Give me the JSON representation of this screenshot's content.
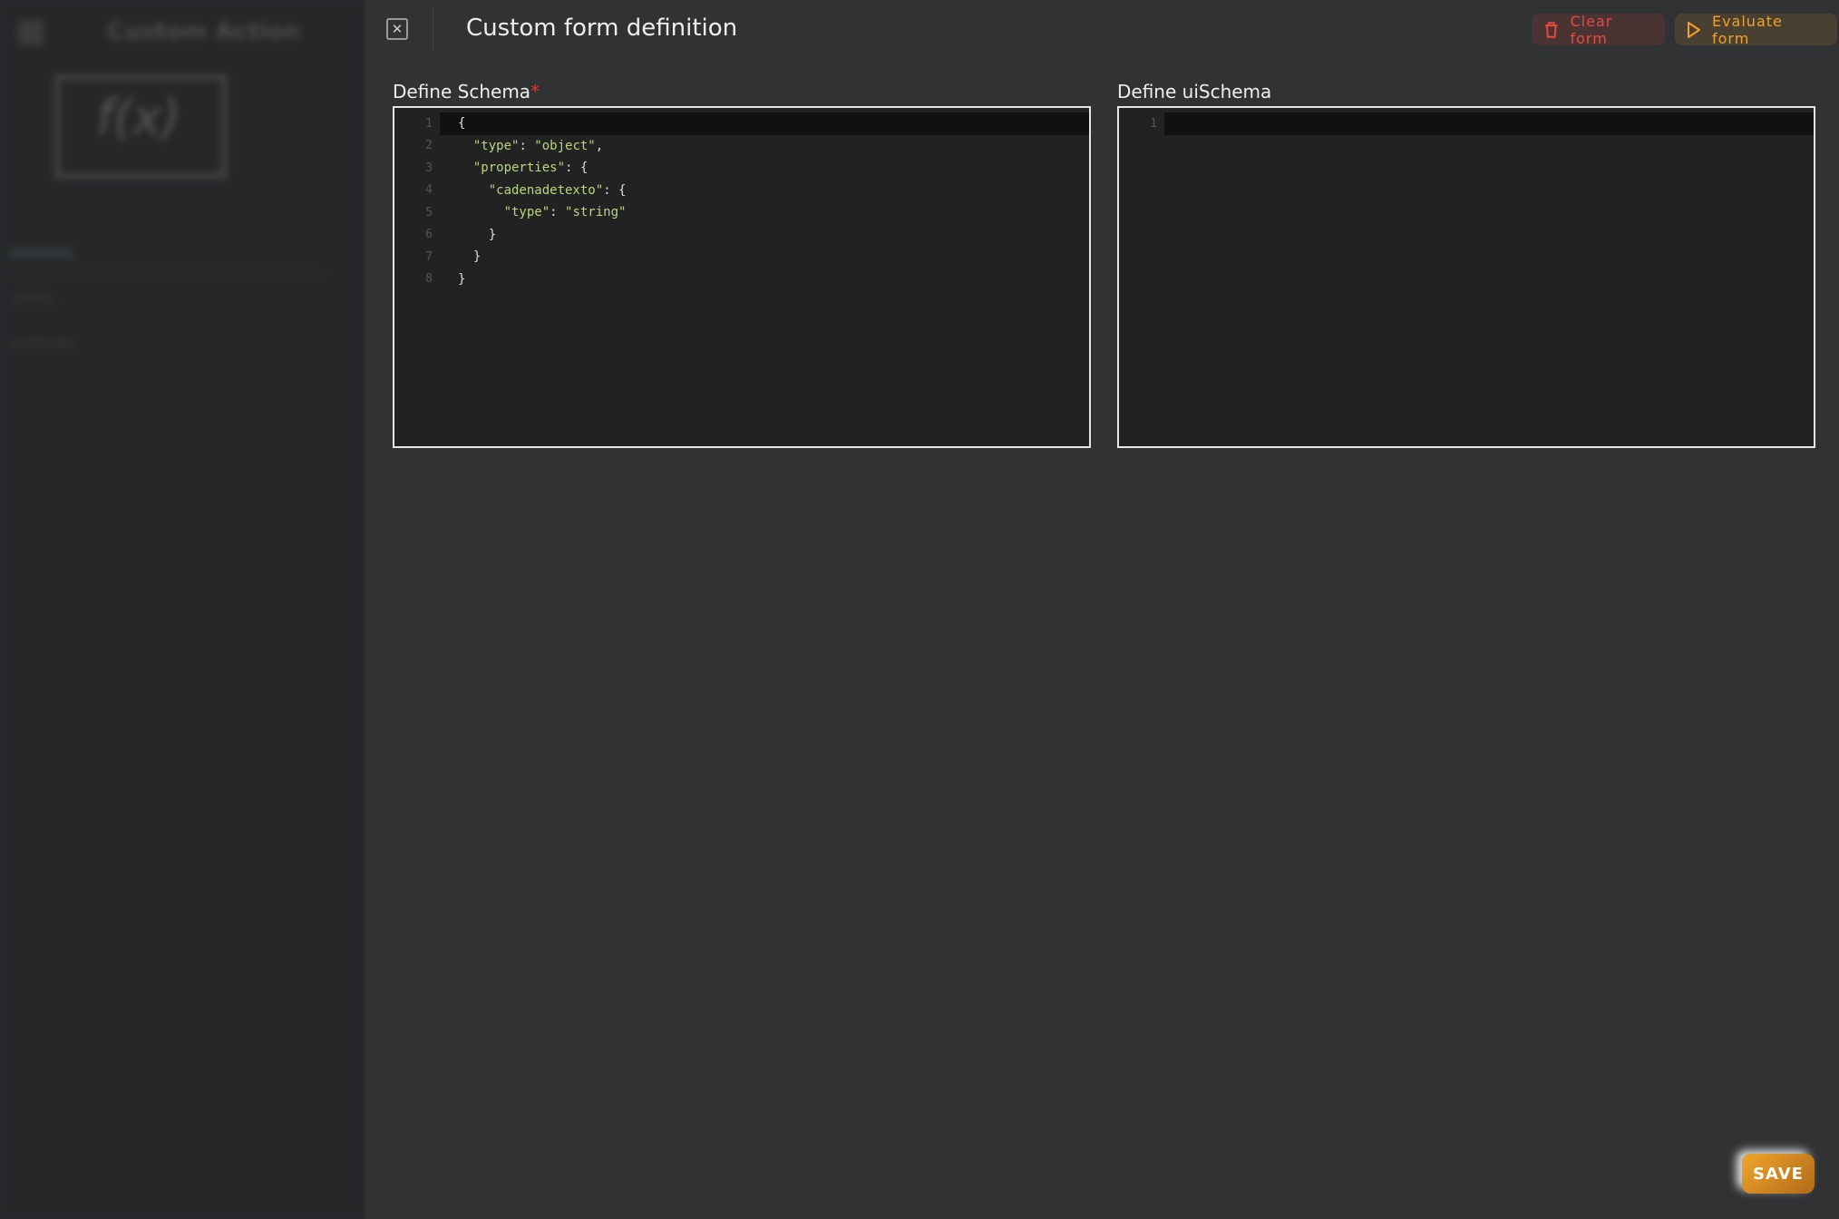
{
  "background": {
    "title": "Custom Action",
    "nav": [
      "GENERAL",
      "USERS",
      "SUPPORT"
    ]
  },
  "header": {
    "title": "Custom form definition",
    "close_icon": "close-x-icon",
    "clear_label": "Clear form",
    "evaluate_label": "Evaluate form"
  },
  "schema": {
    "label": "Define Schema",
    "required_mark": "*",
    "lines": [
      [
        "",
        "{"
      ],
      [
        "  ",
        "\"type\"",
        ": ",
        "\"object\"",
        ","
      ],
      [
        "  ",
        "\"properties\"",
        ": {"
      ],
      [
        "    ",
        "\"cadenadetexto\"",
        ": {"
      ],
      [
        "      ",
        "\"type\"",
        ": ",
        "\"string\""
      ],
      [
        "    ",
        "}"
      ],
      [
        "  ",
        "}"
      ],
      [
        "",
        "}"
      ]
    ]
  },
  "uischema": {
    "label": "Define uiSchema",
    "lines": [
      [
        ""
      ]
    ]
  },
  "save_label": "SAVE",
  "colors": {
    "clear": "#e84a3f",
    "evaluate": "#f0a12a",
    "save": "#f0a52a",
    "string": "#b9d77d"
  }
}
